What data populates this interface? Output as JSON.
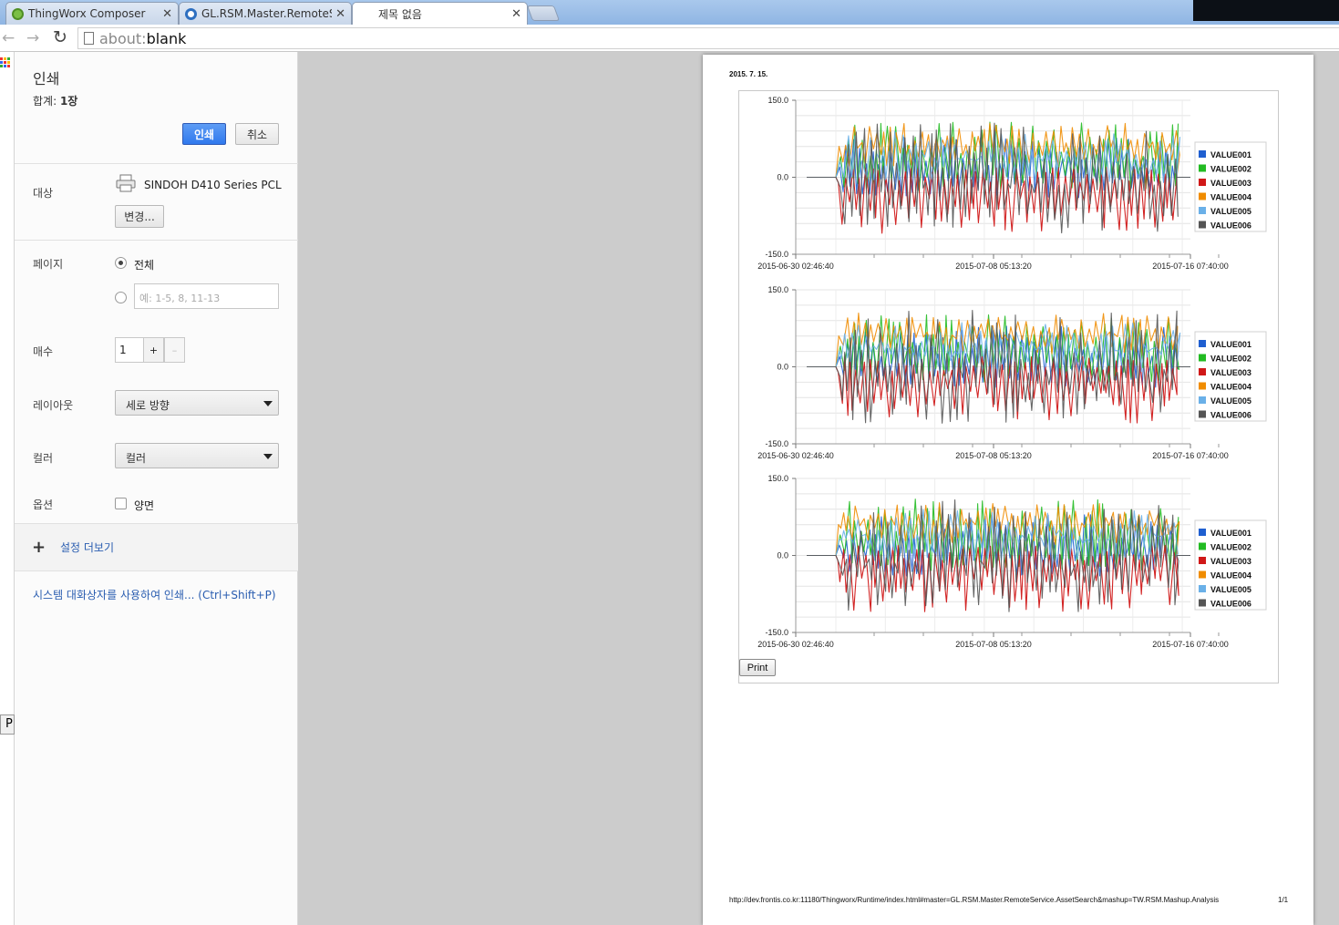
{
  "tabs": [
    {
      "label": "ThingWorx Composer",
      "icon": "thingworx-icon",
      "color": "#7bbf45"
    },
    {
      "label": "GL.RSM.Master.RemoteSe",
      "icon": "mashup-icon",
      "color": "#2d6fc0"
    },
    {
      "label": "제목 없음",
      "icon": "blank-page-icon",
      "color": ""
    }
  ],
  "toolbar": {
    "back_icon": "back-arrow-icon",
    "forward_icon": "forward-arrow-icon",
    "reload_icon": "reload-icon",
    "url_scheme": "about:",
    "url_host": "blank"
  },
  "left_stub": {
    "label": "P"
  },
  "print_panel": {
    "title": "인쇄",
    "total_label": "합계: ",
    "total_value": "1장",
    "print_button": "인쇄",
    "cancel_button": "취소",
    "destination_label": "대상",
    "printer_name": "SINDOH D410 Series PCL",
    "change_button": "변경...",
    "pages_label": "페이지",
    "pages_all": "전체",
    "pages_placeholder": "예: 1-5, 8, 11-13",
    "pages_selected": "all",
    "copies_label": "매수",
    "copies_value": "1",
    "copies_plus": "+",
    "copies_minus": "–",
    "layout_label": "레이아웃",
    "layout_value": "세로 방향",
    "color_label": "컬러",
    "color_value": "컬러",
    "options_label": "옵션",
    "duplex_label": "양면",
    "duplex_checked": false,
    "more_settings": "설정 더보기",
    "system_dialog": "시스템 대화상자를 사용하여 인쇄... (Ctrl+Shift+P)",
    "accent_color": "#3b7ef0"
  },
  "preview": {
    "date": "2015. 7. 15.",
    "footer_url": "http://dev.frontis.co.kr:11180/Thingworx/Runtime/index.html#master=GL.RSM.Master.RemoteService.AssetSearch&mashup=TW.RSM.Mashup.Analysis",
    "page_number": "1/1",
    "print_button": "Print"
  },
  "chart_data": [
    {
      "type": "line",
      "yticks": [
        "150.0",
        "0.0",
        "-150.0"
      ],
      "xticks": [
        "2015-06-30 02:46:40",
        "2015-07-08 05:13:20",
        "2015-07-16 07:40:00"
      ],
      "ylim": [
        -150,
        150
      ],
      "legend_placement": "right",
      "series": [
        {
          "name": "VALUE001",
          "color": "#1f5fd0"
        },
        {
          "name": "VALUE002",
          "color": "#22bb22"
        },
        {
          "name": "VALUE003",
          "color": "#d01818"
        },
        {
          "name": "VALUE004",
          "color": "#f08c00"
        },
        {
          "name": "VALUE005",
          "color": "#6ab0e8"
        },
        {
          "name": "VALUE006",
          "color": "#555555"
        }
      ]
    },
    {
      "type": "line",
      "yticks": [
        "150.0",
        "0.0",
        "-150.0"
      ],
      "xticks": [
        "2015-06-30 02:46:40",
        "2015-07-08 05:13:20",
        "2015-07-16 07:40:00"
      ],
      "ylim": [
        -150,
        150
      ],
      "legend_placement": "right",
      "series": [
        {
          "name": "VALUE001",
          "color": "#1f5fd0"
        },
        {
          "name": "VALUE002",
          "color": "#22bb22"
        },
        {
          "name": "VALUE003",
          "color": "#d01818"
        },
        {
          "name": "VALUE004",
          "color": "#f08c00"
        },
        {
          "name": "VALUE005",
          "color": "#6ab0e8"
        },
        {
          "name": "VALUE006",
          "color": "#555555"
        }
      ]
    },
    {
      "type": "line",
      "yticks": [
        "150.0",
        "0.0",
        "-150.0"
      ],
      "xticks": [
        "2015-06-30 02:46:40",
        "2015-07-08 05:13:20",
        "2015-07-16 07:40:00"
      ],
      "ylim": [
        -150,
        150
      ],
      "legend_placement": "right",
      "series": [
        {
          "name": "VALUE001",
          "color": "#1f5fd0"
        },
        {
          "name": "VALUE002",
          "color": "#22bb22"
        },
        {
          "name": "VALUE003",
          "color": "#d01818"
        },
        {
          "name": "VALUE004",
          "color": "#f08c00"
        },
        {
          "name": "VALUE005",
          "color": "#6ab0e8"
        },
        {
          "name": "VALUE006",
          "color": "#555555"
        }
      ]
    }
  ]
}
